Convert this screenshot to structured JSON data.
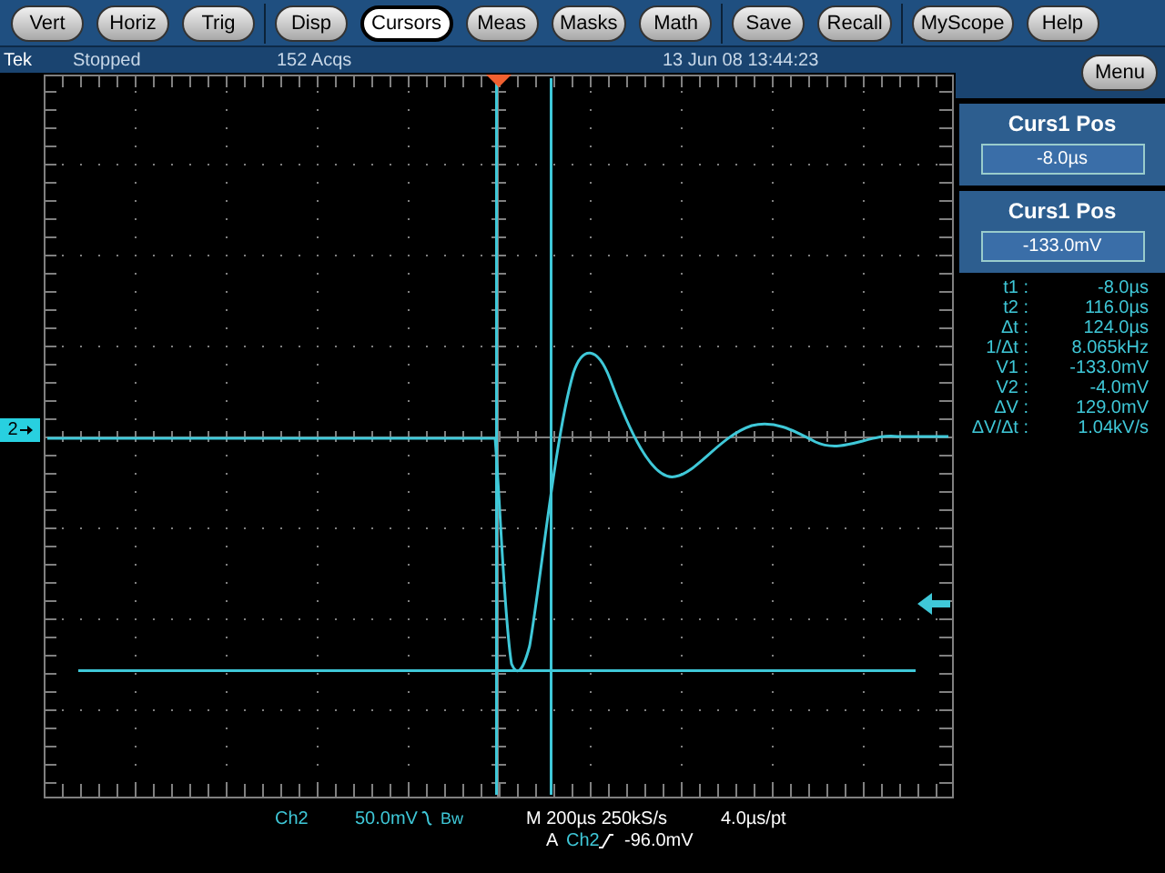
{
  "menu_bar": {
    "groups": [
      [
        {
          "label": "Vert",
          "selected": false
        },
        {
          "label": "Horiz",
          "selected": false
        },
        {
          "label": "Trig",
          "selected": false
        }
      ],
      [
        {
          "label": "Disp",
          "selected": false
        },
        {
          "label": "Cursors",
          "selected": true
        },
        {
          "label": "Meas",
          "selected": false
        },
        {
          "label": "Masks",
          "selected": false
        },
        {
          "label": "Math",
          "selected": false
        }
      ],
      [
        {
          "label": "Save",
          "selected": false
        },
        {
          "label": "Recall",
          "selected": false
        }
      ],
      [
        {
          "label": "MyScope",
          "selected": false
        },
        {
          "label": "Help",
          "selected": false
        }
      ]
    ]
  },
  "status_bar": {
    "brand": "Tek",
    "state": "Stopped",
    "acquisitions": "152 Acqs",
    "datetime": "13 Jun 08 13:44:23"
  },
  "display": {
    "channel_marker": "2"
  },
  "side_panel": {
    "menu_button": "Menu",
    "controls": [
      {
        "title": "Curs1 Pos",
        "value": "-8.0µs"
      },
      {
        "title": "Curs1 Pos",
        "value": "-133.0mV"
      }
    ],
    "readouts": [
      {
        "label": "t1 :",
        "value": "-8.0µs"
      },
      {
        "label": "t2 :",
        "value": "116.0µs"
      },
      {
        "label": "Δt :",
        "value": "124.0µs"
      },
      {
        "label": "1/Δt :",
        "value": "8.065kHz"
      },
      {
        "label": "V1 :",
        "value": "-133.0mV"
      },
      {
        "label": "V2 :",
        "value": "-4.0mV"
      },
      {
        "label": "ΔV :",
        "value": "129.0mV"
      },
      {
        "label": "ΔV/Δt :",
        "value": "1.04kV/s"
      }
    ]
  },
  "readout_bar": {
    "channel": "Ch2",
    "scale": "50.0mV",
    "bandwidth": "Bw",
    "timebase": "M 200µs 250kS/s",
    "resolution": "4.0µs/pt",
    "trigger_prefix": "A",
    "trigger_channel": "Ch2",
    "trigger_level": "-96.0mV"
  }
}
